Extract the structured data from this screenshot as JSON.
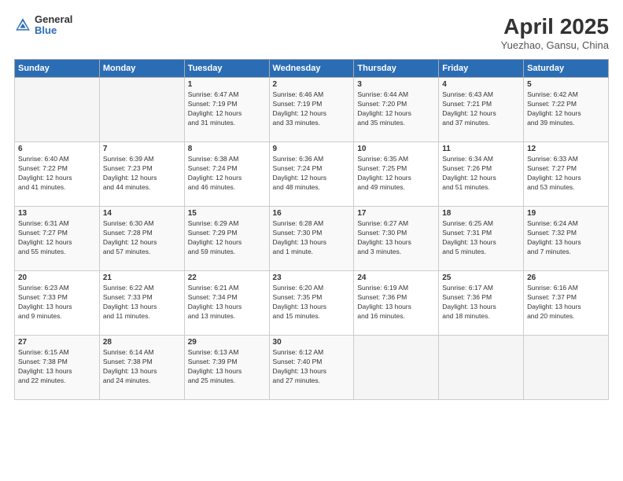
{
  "header": {
    "logo_general": "General",
    "logo_blue": "Blue",
    "title": "April 2025",
    "location": "Yuezhao, Gansu, China"
  },
  "days_of_week": [
    "Sunday",
    "Monday",
    "Tuesday",
    "Wednesday",
    "Thursday",
    "Friday",
    "Saturday"
  ],
  "weeks": [
    [
      {
        "day": "",
        "info": ""
      },
      {
        "day": "",
        "info": ""
      },
      {
        "day": "1",
        "info": "Sunrise: 6:47 AM\nSunset: 7:19 PM\nDaylight: 12 hours\nand 31 minutes."
      },
      {
        "day": "2",
        "info": "Sunrise: 6:46 AM\nSunset: 7:19 PM\nDaylight: 12 hours\nand 33 minutes."
      },
      {
        "day": "3",
        "info": "Sunrise: 6:44 AM\nSunset: 7:20 PM\nDaylight: 12 hours\nand 35 minutes."
      },
      {
        "day": "4",
        "info": "Sunrise: 6:43 AM\nSunset: 7:21 PM\nDaylight: 12 hours\nand 37 minutes."
      },
      {
        "day": "5",
        "info": "Sunrise: 6:42 AM\nSunset: 7:22 PM\nDaylight: 12 hours\nand 39 minutes."
      }
    ],
    [
      {
        "day": "6",
        "info": "Sunrise: 6:40 AM\nSunset: 7:22 PM\nDaylight: 12 hours\nand 41 minutes."
      },
      {
        "day": "7",
        "info": "Sunrise: 6:39 AM\nSunset: 7:23 PM\nDaylight: 12 hours\nand 44 minutes."
      },
      {
        "day": "8",
        "info": "Sunrise: 6:38 AM\nSunset: 7:24 PM\nDaylight: 12 hours\nand 46 minutes."
      },
      {
        "day": "9",
        "info": "Sunrise: 6:36 AM\nSunset: 7:24 PM\nDaylight: 12 hours\nand 48 minutes."
      },
      {
        "day": "10",
        "info": "Sunrise: 6:35 AM\nSunset: 7:25 PM\nDaylight: 12 hours\nand 49 minutes."
      },
      {
        "day": "11",
        "info": "Sunrise: 6:34 AM\nSunset: 7:26 PM\nDaylight: 12 hours\nand 51 minutes."
      },
      {
        "day": "12",
        "info": "Sunrise: 6:33 AM\nSunset: 7:27 PM\nDaylight: 12 hours\nand 53 minutes."
      }
    ],
    [
      {
        "day": "13",
        "info": "Sunrise: 6:31 AM\nSunset: 7:27 PM\nDaylight: 12 hours\nand 55 minutes."
      },
      {
        "day": "14",
        "info": "Sunrise: 6:30 AM\nSunset: 7:28 PM\nDaylight: 12 hours\nand 57 minutes."
      },
      {
        "day": "15",
        "info": "Sunrise: 6:29 AM\nSunset: 7:29 PM\nDaylight: 12 hours\nand 59 minutes."
      },
      {
        "day": "16",
        "info": "Sunrise: 6:28 AM\nSunset: 7:30 PM\nDaylight: 13 hours\nand 1 minute."
      },
      {
        "day": "17",
        "info": "Sunrise: 6:27 AM\nSunset: 7:30 PM\nDaylight: 13 hours\nand 3 minutes."
      },
      {
        "day": "18",
        "info": "Sunrise: 6:25 AM\nSunset: 7:31 PM\nDaylight: 13 hours\nand 5 minutes."
      },
      {
        "day": "19",
        "info": "Sunrise: 6:24 AM\nSunset: 7:32 PM\nDaylight: 13 hours\nand 7 minutes."
      }
    ],
    [
      {
        "day": "20",
        "info": "Sunrise: 6:23 AM\nSunset: 7:33 PM\nDaylight: 13 hours\nand 9 minutes."
      },
      {
        "day": "21",
        "info": "Sunrise: 6:22 AM\nSunset: 7:33 PM\nDaylight: 13 hours\nand 11 minutes."
      },
      {
        "day": "22",
        "info": "Sunrise: 6:21 AM\nSunset: 7:34 PM\nDaylight: 13 hours\nand 13 minutes."
      },
      {
        "day": "23",
        "info": "Sunrise: 6:20 AM\nSunset: 7:35 PM\nDaylight: 13 hours\nand 15 minutes."
      },
      {
        "day": "24",
        "info": "Sunrise: 6:19 AM\nSunset: 7:36 PM\nDaylight: 13 hours\nand 16 minutes."
      },
      {
        "day": "25",
        "info": "Sunrise: 6:17 AM\nSunset: 7:36 PM\nDaylight: 13 hours\nand 18 minutes."
      },
      {
        "day": "26",
        "info": "Sunrise: 6:16 AM\nSunset: 7:37 PM\nDaylight: 13 hours\nand 20 minutes."
      }
    ],
    [
      {
        "day": "27",
        "info": "Sunrise: 6:15 AM\nSunset: 7:38 PM\nDaylight: 13 hours\nand 22 minutes."
      },
      {
        "day": "28",
        "info": "Sunrise: 6:14 AM\nSunset: 7:38 PM\nDaylight: 13 hours\nand 24 minutes."
      },
      {
        "day": "29",
        "info": "Sunrise: 6:13 AM\nSunset: 7:39 PM\nDaylight: 13 hours\nand 25 minutes."
      },
      {
        "day": "30",
        "info": "Sunrise: 6:12 AM\nSunset: 7:40 PM\nDaylight: 13 hours\nand 27 minutes."
      },
      {
        "day": "",
        "info": ""
      },
      {
        "day": "",
        "info": ""
      },
      {
        "day": "",
        "info": ""
      }
    ]
  ]
}
